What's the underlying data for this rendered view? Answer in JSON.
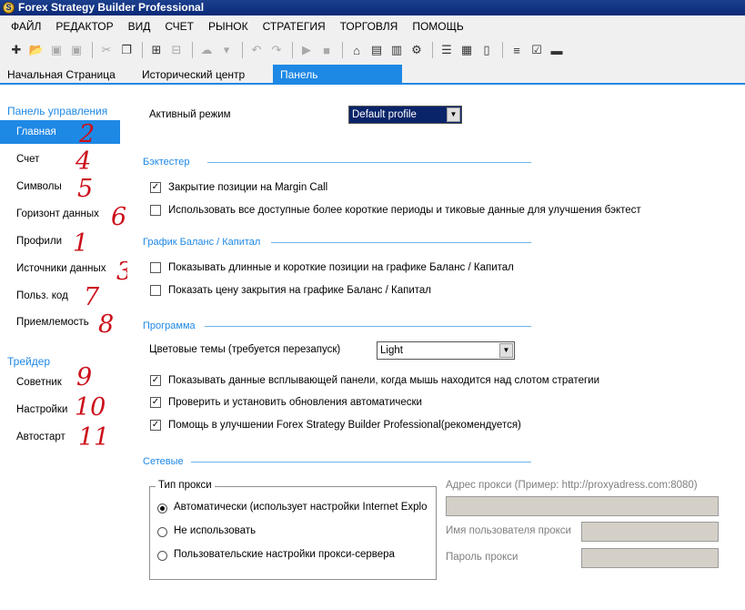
{
  "window": {
    "title": "Forex Strategy Builder Professional",
    "icon": "app-icon"
  },
  "menu": [
    "ФАЙЛ",
    "РЕДАКТОР",
    "ВИД",
    "СЧЕТ",
    "РЫНОК",
    "СТРАТЕГИЯ",
    "ТОРГОВЛЯ",
    "ПОМОЩЬ"
  ],
  "tabs": {
    "home": "Начальная Страница",
    "history": "Исторический центр",
    "control": "Панель управления"
  },
  "sidebar": {
    "group1": "Панель управления",
    "items1": [
      "Главная",
      "Счет",
      "Символы",
      "Горизонт данных",
      "Профили",
      "Источники данных",
      "Польз. код",
      "Приемлемость"
    ],
    "group2": "Трейдер",
    "items2": [
      "Советник",
      "Настройки",
      "Автостарт"
    ]
  },
  "annotations": [
    "2",
    "4",
    "5",
    "6",
    "1",
    "3",
    "7",
    "8",
    "9",
    "10",
    "11"
  ],
  "main": {
    "active_mode_label": "Активный режим",
    "active_mode_value": "Default profile",
    "backtester": {
      "title": "Бэктестер",
      "margin_call": "Закрытие позиции на Margin Call",
      "margin_call_checked": true,
      "shorter_periods": "Использовать все доступные более короткие периоды и тиковые данные для улучшения бэктест",
      "shorter_periods_checked": false
    },
    "balance_chart": {
      "title": "График Баланс / Капитал",
      "long_short": "Показывать длинные и короткие позиции на графике Баланс / Капитал",
      "long_short_checked": false,
      "close_price": "Показать цену закрытия на графике Баланс / Капитал",
      "close_price_checked": false
    },
    "program": {
      "title": "Программа",
      "theme_label": "Цветовые темы (требуется перезапуск)",
      "theme_value": "Light",
      "popup_data": "Показывать данные всплывающей панели, когда мышь находится над слотом стратегии",
      "popup_data_checked": true,
      "check_updates": "Проверить и установить обновления автоматически",
      "check_updates_checked": true,
      "help_improve": "Помощь в улучшении Forex Strategy Builder Professional(рекомендуется)",
      "help_improve_checked": true
    },
    "network": {
      "title": "Сетевые",
      "proxy_type_title": "Тип прокси",
      "proxy_auto": "Автоматически (использует настройки Internet Explo",
      "proxy_none": "Не использовать",
      "proxy_custom": "Пользовательские настройки прокси-сервера",
      "proxy_selected": "auto",
      "proxy_address_label": "Адрес прокси (Пример: http://proxyadress.com:8080)",
      "proxy_user_label": "Имя пользователя прокси",
      "proxy_password_label": "Пароль прокси"
    }
  }
}
